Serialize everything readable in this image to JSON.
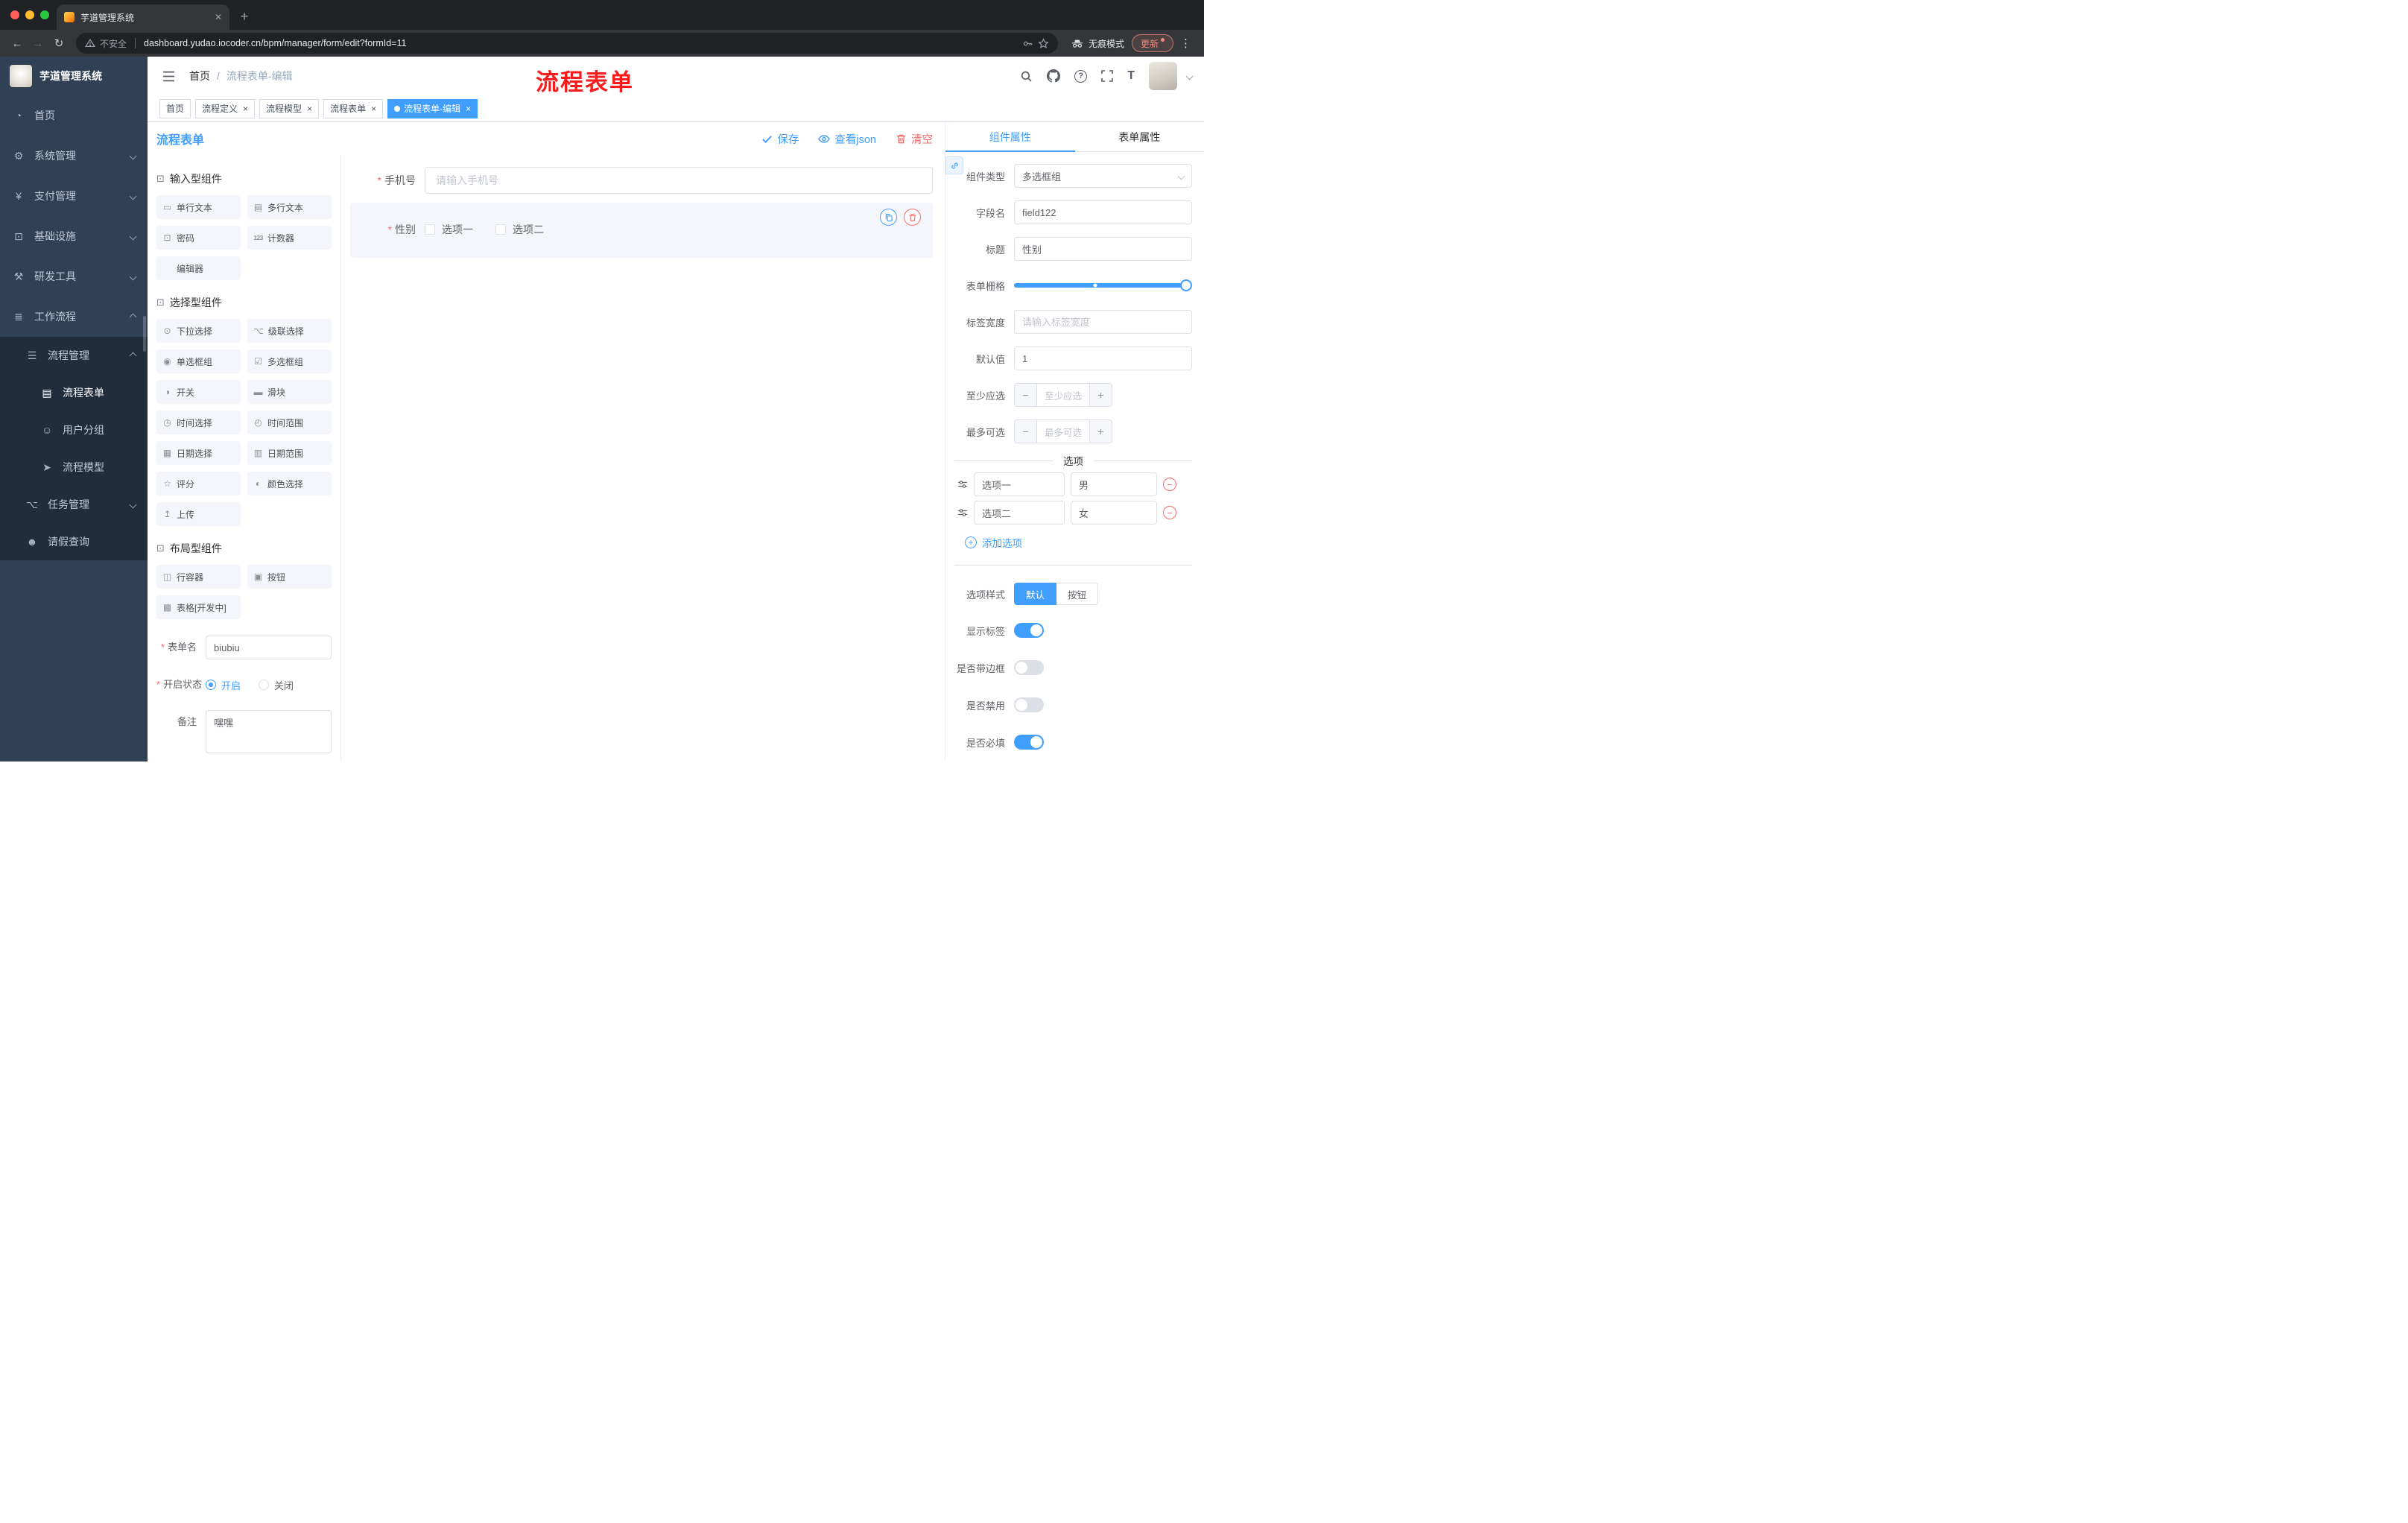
{
  "browser": {
    "tab_title": "芋道管理系统",
    "close": "✕",
    "new_tab": "+",
    "back": "←",
    "forward": "→",
    "reload": "↻",
    "security": "不安全",
    "url": "dashboard.yudao.iocoder.cn/bpm/manager/form/edit?formId=11",
    "incognito": "无痕模式",
    "update": "更新",
    "kebab": "⋮"
  },
  "sidebar": {
    "logo_title": "芋道管理系统",
    "items": [
      {
        "icon": "◔",
        "label": "首页"
      },
      {
        "icon": "⚙",
        "label": "系统管理"
      },
      {
        "icon": "¥",
        "label": "支付管理"
      },
      {
        "icon": "⊡",
        "label": "基础设施"
      },
      {
        "icon": "⚒",
        "label": "研发工具"
      },
      {
        "icon": "≣",
        "label": "工作流程"
      }
    ],
    "submenu": {
      "process_mgmt": {
        "icon": "☰",
        "label": "流程管理"
      },
      "process_form": {
        "icon": "▤",
        "label": "流程表单"
      },
      "user_group": {
        "icon": "☺",
        "label": "用户分组"
      },
      "process_model": {
        "icon": "➤",
        "label": "流程模型"
      },
      "task_mgmt": {
        "icon": "⌥",
        "label": "任务管理"
      },
      "leave_query": {
        "icon": "☻",
        "label": "请假查询"
      }
    }
  },
  "navbar": {
    "breadcrumb_root": "首页",
    "breadcrumb_sep": "/",
    "breadcrumb_current": "流程表单-编辑",
    "annotation": "流程表单",
    "fontsize_icon": "T"
  },
  "tags": [
    {
      "label": "首页"
    },
    {
      "label": "流程定义",
      "close": "×"
    },
    {
      "label": "流程模型",
      "close": "×"
    },
    {
      "label": "流程表单",
      "close": "×"
    },
    {
      "label": "流程表单-编辑",
      "close": "×"
    }
  ],
  "editor": {
    "title": "流程表单",
    "save": "保存",
    "view_json": "查看json",
    "clear": "清空"
  },
  "palette": {
    "sections": [
      {
        "icon": "⊡",
        "title": "输入型组件",
        "items": [
          {
            "icon": "▭",
            "label": "单行文本"
          },
          {
            "icon": "▤",
            "label": "多行文本"
          },
          {
            "icon": "⊡",
            "label": "密码"
          },
          {
            "icon": "123",
            "label": "计数器"
          },
          {
            "icon": "",
            "label": "编辑器"
          }
        ]
      },
      {
        "icon": "⊡",
        "title": "选择型组件",
        "items": [
          {
            "icon": "⊙",
            "label": "下拉选择"
          },
          {
            "icon": "⌥",
            "label": "级联选择"
          },
          {
            "icon": "◉",
            "label": "单选框组"
          },
          {
            "icon": "☑",
            "label": "多选框组"
          },
          {
            "icon": "◑",
            "label": "开关"
          },
          {
            "icon": "▬",
            "label": "滑块"
          },
          {
            "icon": "◷",
            "label": "时间选择"
          },
          {
            "icon": "◴",
            "label": "时间范围"
          },
          {
            "icon": "▦",
            "label": "日期选择"
          },
          {
            "icon": "▥",
            "label": "日期范围"
          },
          {
            "icon": "☆",
            "label": "评分"
          },
          {
            "icon": "◐",
            "label": "颜色选择"
          },
          {
            "icon": "↥",
            "label": "上传"
          }
        ]
      },
      {
        "icon": "⊡",
        "title": "布局型组件",
        "items": [
          {
            "icon": "◫",
            "label": "行容器"
          },
          {
            "icon": "▣",
            "label": "按钮"
          },
          {
            "icon": "▩",
            "label": "表格[开发中]"
          }
        ]
      }
    ],
    "form": {
      "name_label": "表单名",
      "name_value": "biubiu",
      "status_label": "开启状态",
      "status_on": "开启",
      "status_off": "关闭",
      "remark_label": "备注",
      "remark_value": "嘿嘿"
    }
  },
  "canvas": {
    "phone_label": "手机号",
    "phone_placeholder": "请输入手机号",
    "gender_label": "性别",
    "gender_opt1": "选项一",
    "gender_opt2": "选项二"
  },
  "props": {
    "tab_component": "组件属性",
    "tab_form": "表单属性",
    "component_type_label": "组件类型",
    "component_type_value": "多选框组",
    "field_label": "字段名",
    "field_value": "field122",
    "title_label": "标题",
    "title_value": "性别",
    "grid_label": "表单栅格",
    "label_width_label": "标签宽度",
    "label_width_placeholder": "请输入标签宽度",
    "default_label": "默认值",
    "default_value": "1",
    "min_label": "至少应选",
    "min_placeholder": "至少应选",
    "max_label": "最多可选",
    "max_placeholder": "最多可选",
    "minus": "−",
    "plus": "+",
    "options_divider": "选项",
    "options": [
      {
        "label": "选项一",
        "value": "男"
      },
      {
        "label": "选项二",
        "value": "女"
      }
    ],
    "add_option": "添加选项",
    "style_label": "选项样式",
    "style_default": "默认",
    "style_button": "按钮",
    "toggle_show_label": "显示标签",
    "toggle_border": "是否带边框",
    "toggle_disabled": "是否禁用",
    "toggle_required": "是否必填"
  },
  "colors": {
    "accent": "#409eff",
    "danger": "#f56c6c",
    "sidebar": "#304156",
    "annotation": "#fd1a1a"
  }
}
